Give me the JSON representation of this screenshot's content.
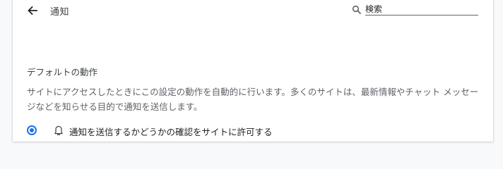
{
  "header": {
    "back_icon": "arrow-left-icon",
    "title": "通知",
    "search": {
      "icon": "search-icon",
      "value": "検索"
    }
  },
  "default_behavior": {
    "heading": "デフォルトの動作",
    "description": "サイトにアクセスしたときにこの設定の動作を自動的に行います。多くのサイトは、最新情報やチャット メッセージなどを知らせる目的で通知を送信します。",
    "options": [
      {
        "icon": "bell-icon",
        "label": "通知を送信するかどうかの確認をサイトに許可する",
        "selected": true
      }
    ]
  },
  "colors": {
    "accent": "#1a73e8",
    "text_primary": "#202124",
    "text_secondary": "#5f6368"
  }
}
